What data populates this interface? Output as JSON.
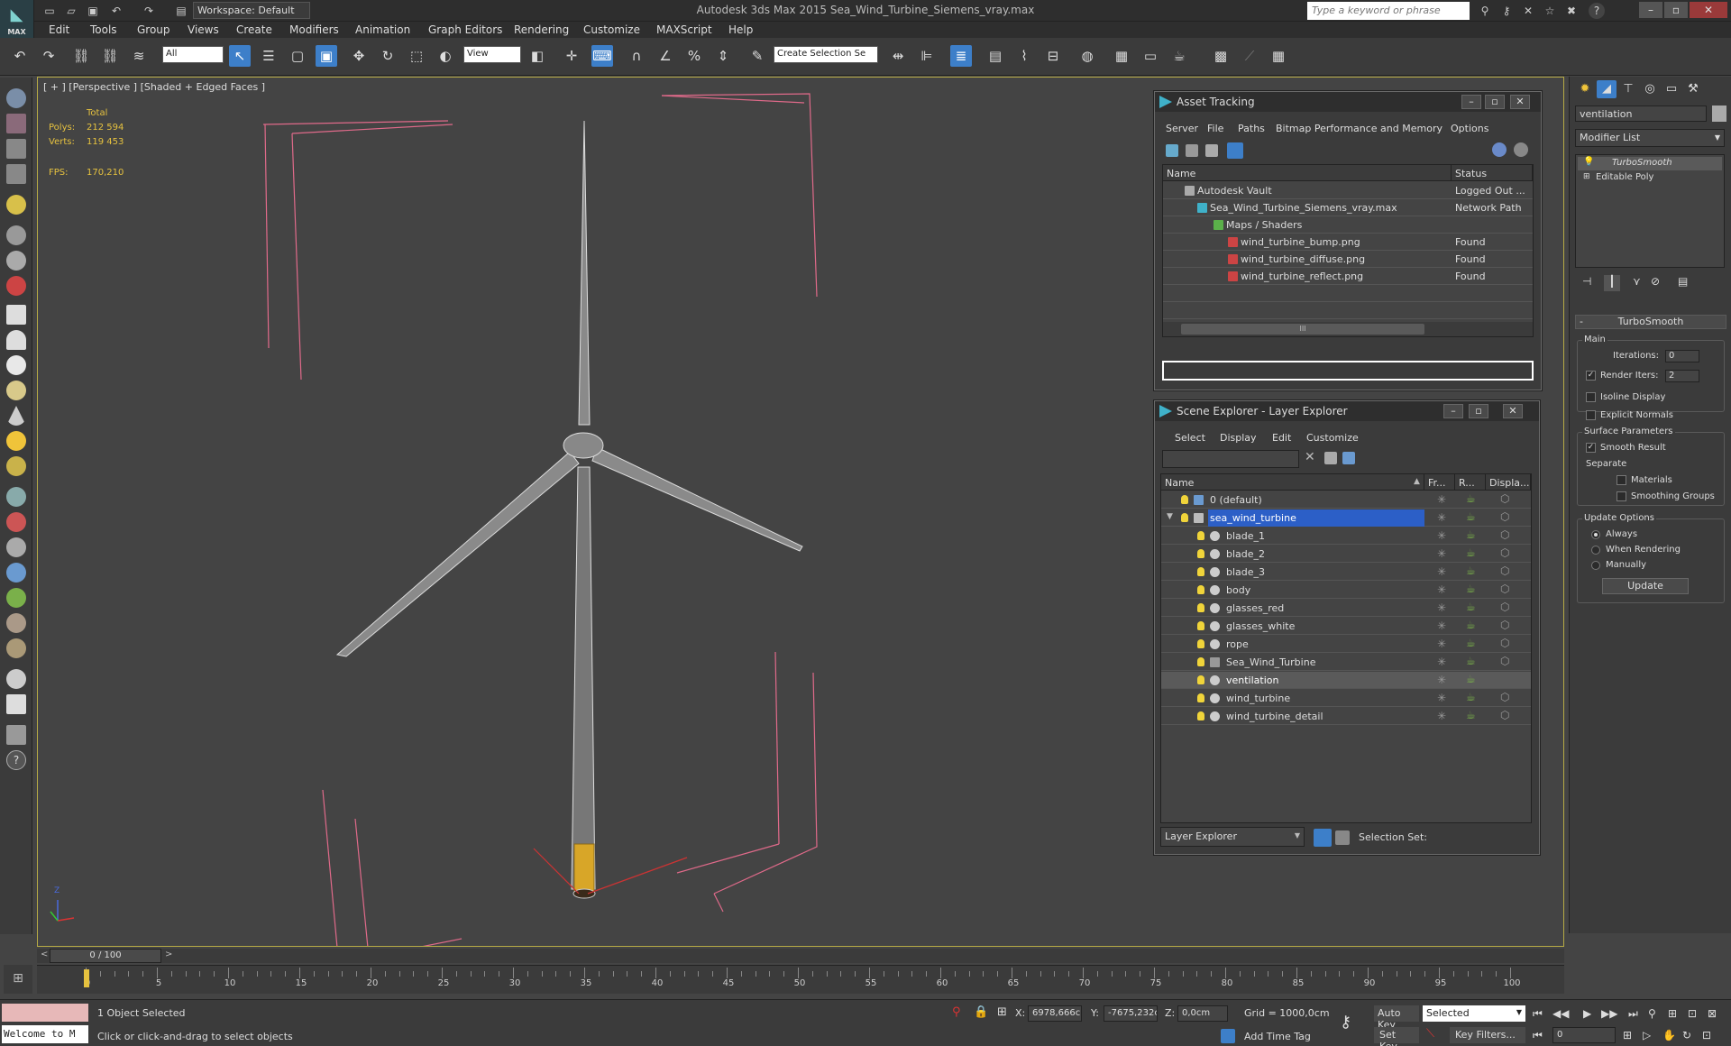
{
  "app": {
    "logo": "MAX",
    "title": "Autodesk 3ds Max  2015    Sea_Wind_Turbine_Siemens_vray.max",
    "workspace": "Workspace: Default",
    "search_placeholder": "Type a keyword or phrase"
  },
  "menu": [
    "Edit",
    "Tools",
    "Group",
    "Views",
    "Create",
    "Modifiers",
    "Animation",
    "Graph Editors",
    "Rendering",
    "Customize",
    "MAXScript",
    "Help"
  ],
  "toolbar": {
    "filter": "All",
    "coord": "View",
    "selection_set": "Create Selection Se"
  },
  "viewport": {
    "label": "[ + ] [Perspective ] [Shaded + Edged Faces ]",
    "stats": {
      "total_label": "Total",
      "polys_label": "Polys:",
      "polys": "212 594",
      "verts_label": "Verts:",
      "verts": "119 453",
      "fps_label": "FPS:",
      "fps": "170,210"
    },
    "axis_label": "Z"
  },
  "asset_tracking": {
    "title": "Asset Tracking",
    "menu": [
      "Server",
      "File",
      "Paths",
      "Bitmap Performance and Memory",
      "Options"
    ],
    "columns": [
      "Name",
      "Status"
    ],
    "rows": [
      {
        "name": "Autodesk Vault",
        "status": "Logged Out ..."
      },
      {
        "name": "Sea_Wind_Turbine_Siemens_vray.max",
        "status": "Network Path"
      },
      {
        "name": "Maps / Shaders",
        "status": ""
      },
      {
        "name": "wind_turbine_bump.png",
        "status": "Found"
      },
      {
        "name": "wind_turbine_diffuse.png",
        "status": "Found"
      },
      {
        "name": "wind_turbine_reflect.png",
        "status": "Found"
      }
    ],
    "scroll_grip": "III"
  },
  "scene_explorer": {
    "title": "Scene Explorer - Layer Explorer",
    "menu": [
      "Select",
      "Display",
      "Edit",
      "Customize"
    ],
    "columns": [
      "Name",
      "Fr...",
      "R...",
      "Displa..."
    ],
    "rows": [
      {
        "name": "0 (default)",
        "type": "layer"
      },
      {
        "name": "sea_wind_turbine",
        "type": "layer"
      },
      {
        "name": "blade_1",
        "type": "object"
      },
      {
        "name": "blade_2",
        "type": "object"
      },
      {
        "name": "blade_3",
        "type": "object"
      },
      {
        "name": "body",
        "type": "object"
      },
      {
        "name": "glasses_red",
        "type": "object"
      },
      {
        "name": "glasses_white",
        "type": "object"
      },
      {
        "name": "rope",
        "type": "object"
      },
      {
        "name": "Sea_Wind_Turbine",
        "type": "group"
      },
      {
        "name": "ventilation",
        "type": "object"
      },
      {
        "name": "wind_turbine",
        "type": "object"
      },
      {
        "name": "wind_turbine_detail",
        "type": "object"
      }
    ],
    "footer_mode": "Layer Explorer",
    "footer_selset": "Selection Set:"
  },
  "command_panel": {
    "object_name": "ventilation",
    "modifier_list": "Modifier List",
    "stack": [
      "TurboSmooth",
      "Editable Poly"
    ],
    "rollout_title": "TurboSmooth",
    "main_label": "Main",
    "iterations_label": "Iterations:",
    "iterations": "0",
    "render_iters_label": "Render Iters:",
    "render_iters": "2",
    "isoline": "Isoline Display",
    "explicit": "Explicit Normals",
    "surface_label": "Surface Parameters",
    "smooth_result": "Smooth Result",
    "separate_label": "Separate",
    "materials": "Materials",
    "smoothing_groups": "Smoothing Groups",
    "update_label": "Update Options",
    "always": "Always",
    "when_rendering": "When Rendering",
    "manually": "Manually",
    "update_button": "Update"
  },
  "timeline": {
    "frame": "0 / 100",
    "ticks": [
      "0",
      "5",
      "10",
      "15",
      "20",
      "25",
      "30",
      "35",
      "40",
      "45",
      "50",
      "55",
      "60",
      "65",
      "70",
      "75",
      "80",
      "85",
      "90",
      "95",
      "100"
    ]
  },
  "status": {
    "welcome": "Welcome to M",
    "selected": "1 Object Selected",
    "prompt": "Click or click-and-drag to select objects",
    "x_label": "X:",
    "x": "6978,666c",
    "y_label": "Y:",
    "y": "-7675,232c",
    "z_label": "Z:",
    "z": "0,0cm",
    "grid": "Grid = 1000,0cm",
    "add_time_tag": "Add Time Tag",
    "auto_key": "Auto Key",
    "set_key": "Set Key",
    "key_mode": "Selected",
    "key_filters": "Key Filters...",
    "frame_field": "0"
  },
  "colors": {
    "accent": "#3d7fc9",
    "selection_row": "#2c5fc7",
    "viewport_border": "#b6aa45",
    "stats": "#e6c23f"
  }
}
